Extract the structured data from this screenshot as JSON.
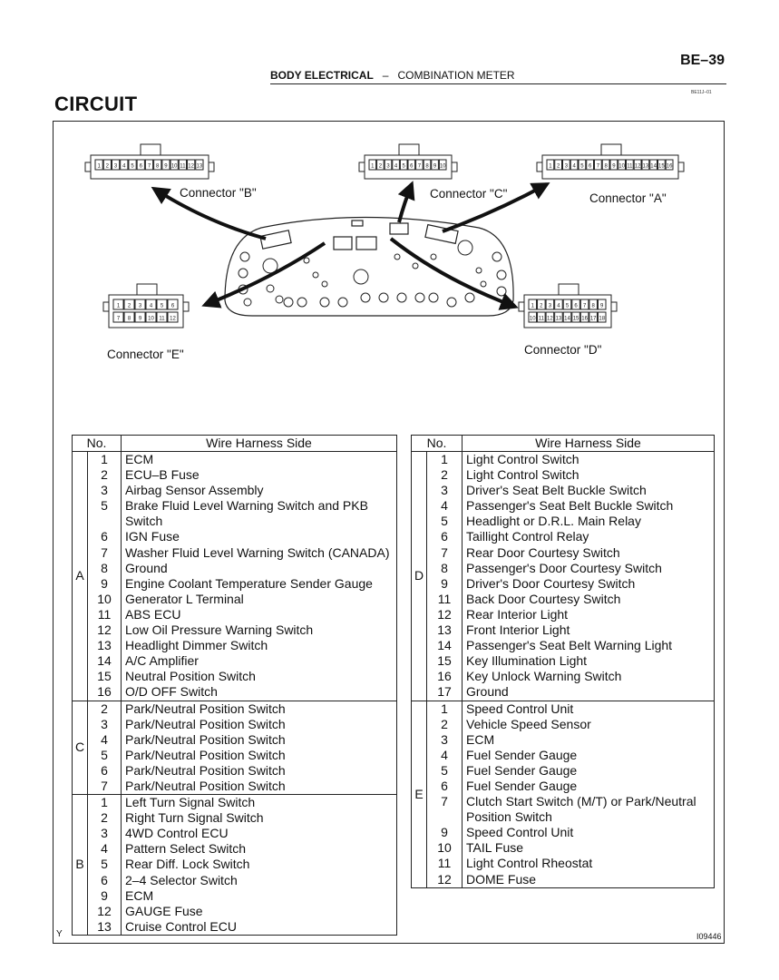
{
  "header": {
    "page_number": "BE–39",
    "section": "BODY ELECTRICAL",
    "separator": "–",
    "subsection": "COMBINATION METER",
    "doc_code": "BE11J–01"
  },
  "title": "CIRCUIT",
  "diagram": {
    "connectors": [
      {
        "id": "B",
        "label": "Connector \"B\"",
        "pins": [
          "1",
          "2",
          "3",
          "4",
          "5",
          "6",
          "7",
          "8",
          "9",
          "10",
          "11",
          "12",
          "13"
        ]
      },
      {
        "id": "C",
        "label": "Connector \"C\"",
        "pins": [
          "1",
          "2",
          "3",
          "4",
          "5",
          "6",
          "7",
          "8",
          "9",
          "10"
        ]
      },
      {
        "id": "A",
        "label": "Connector \"A\"",
        "pins": [
          "1",
          "2",
          "3",
          "4",
          "5",
          "6",
          "7",
          "8",
          "9",
          "10",
          "11",
          "12",
          "13",
          "14",
          "15",
          "16"
        ]
      },
      {
        "id": "E",
        "label": "Connector \"E\"",
        "pins": [
          "1",
          "2",
          "3",
          "4",
          "5",
          "6",
          "7",
          "8",
          "9",
          "10",
          "11",
          "12"
        ]
      },
      {
        "id": "D",
        "label": "Connector \"D\"",
        "pins": [
          "1",
          "2",
          "3",
          "4",
          "5",
          "6",
          "7",
          "8",
          "9",
          "10",
          "11",
          "12",
          "13",
          "14",
          "15",
          "16",
          "17",
          "18"
        ]
      }
    ]
  },
  "table_headers": {
    "no": "No.",
    "side": "Wire Harness Side"
  },
  "left_table": [
    {
      "group": "A",
      "rows": [
        {
          "no": "1",
          "desc": "ECM"
        },
        {
          "no": "2",
          "desc": "ECU–B Fuse"
        },
        {
          "no": "3",
          "desc": "Airbag Sensor Assembly"
        },
        {
          "no": "5",
          "desc": "Brake Fluid Level Warning Switch and PKB Switch"
        },
        {
          "no": "6",
          "desc": "IGN Fuse"
        },
        {
          "no": "7",
          "desc": "Washer Fluid Level Warning Switch (CANADA)"
        },
        {
          "no": "8",
          "desc": "Ground"
        },
        {
          "no": "9",
          "desc": "Engine Coolant Temperature Sender Gauge"
        },
        {
          "no": "10",
          "desc": "Generator L Terminal"
        },
        {
          "no": "11",
          "desc": "ABS ECU"
        },
        {
          "no": "12",
          "desc": "Low Oil Pressure Warning Switch"
        },
        {
          "no": "13",
          "desc": "Headlight Dimmer Switch"
        },
        {
          "no": "14",
          "desc": "A/C Amplifier"
        },
        {
          "no": "15",
          "desc": "Neutral Position Switch"
        },
        {
          "no": "16",
          "desc": "O/D OFF Switch"
        }
      ]
    },
    {
      "group": "C",
      "rows": [
        {
          "no": "2",
          "desc": "Park/Neutral Position Switch"
        },
        {
          "no": "3",
          "desc": "Park/Neutral Position Switch"
        },
        {
          "no": "4",
          "desc": "Park/Neutral Position Switch"
        },
        {
          "no": "5",
          "desc": "Park/Neutral Position Switch"
        },
        {
          "no": "6",
          "desc": "Park/Neutral Position Switch"
        },
        {
          "no": "7",
          "desc": "Park/Neutral Position Switch"
        }
      ]
    },
    {
      "group": "B",
      "rows": [
        {
          "no": "1",
          "desc": "Left Turn Signal Switch"
        },
        {
          "no": "2",
          "desc": "Right Turn Signal Switch"
        },
        {
          "no": "3",
          "desc": "4WD Control ECU"
        },
        {
          "no": "4",
          "desc": "Pattern Select Switch"
        },
        {
          "no": "5",
          "desc": "Rear Diff. Lock Switch"
        },
        {
          "no": "6",
          "desc": "2–4 Selector Switch"
        },
        {
          "no": "9",
          "desc": "ECM"
        },
        {
          "no": "12",
          "desc": "GAUGE Fuse"
        },
        {
          "no": "13",
          "desc": "Cruise Control ECU"
        }
      ]
    }
  ],
  "right_table": [
    {
      "group": "D",
      "rows": [
        {
          "no": "1",
          "desc": "Light Control Switch"
        },
        {
          "no": "2",
          "desc": "Light Control Switch"
        },
        {
          "no": "3",
          "desc": "Driver's Seat Belt Buckle Switch"
        },
        {
          "no": "4",
          "desc": "Passenger's Seat Belt Buckle Switch"
        },
        {
          "no": "5",
          "desc": "Headlight or D.R.L. Main Relay"
        },
        {
          "no": "6",
          "desc": "Taillight Control Relay"
        },
        {
          "no": "7",
          "desc": "Rear Door Courtesy Switch"
        },
        {
          "no": "8",
          "desc": "Passenger's Door Courtesy Switch"
        },
        {
          "no": "9",
          "desc": "Driver's Door Courtesy Switch"
        },
        {
          "no": "11",
          "desc": "Back Door Courtesy Switch"
        },
        {
          "no": "12",
          "desc": "Rear Interior Light"
        },
        {
          "no": "13",
          "desc": "Front Interior Light"
        },
        {
          "no": "14",
          "desc": "Passenger's Seat Belt Warning Light"
        },
        {
          "no": "15",
          "desc": "Key Illumination Light"
        },
        {
          "no": "16",
          "desc": "Key Unlock Warning Switch"
        },
        {
          "no": "17",
          "desc": "Ground"
        }
      ]
    },
    {
      "group": "E",
      "rows": [
        {
          "no": "1",
          "desc": "Speed Control Unit"
        },
        {
          "no": "2",
          "desc": "Vehicle Speed Sensor"
        },
        {
          "no": "3",
          "desc": "ECM"
        },
        {
          "no": "4",
          "desc": "Fuel Sender Gauge"
        },
        {
          "no": "5",
          "desc": "Fuel Sender Gauge"
        },
        {
          "no": "6",
          "desc": "Fuel Sender Gauge"
        },
        {
          "no": "7",
          "desc": "Clutch Start Switch (M/T) or Park/Neutral Position Switch"
        },
        {
          "no": "9",
          "desc": "Speed Control Unit"
        },
        {
          "no": "10",
          "desc": "TAIL Fuse"
        },
        {
          "no": "11",
          "desc": "Light Control Rheostat"
        },
        {
          "no": "12",
          "desc": "DOME Fuse"
        }
      ]
    }
  ],
  "footer": {
    "corner_mark": "Y",
    "figure_code": "I09446"
  }
}
